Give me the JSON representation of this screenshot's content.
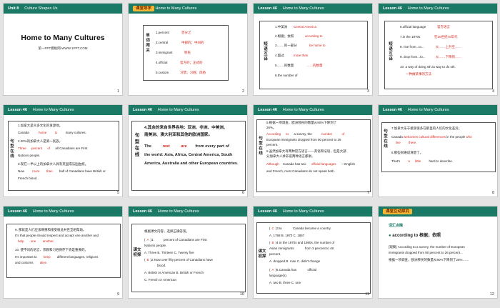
{
  "header": {
    "unit": "Unit 8",
    "unit_title": "Culture Shapes Us",
    "lesson": "Lesson 46",
    "lesson_title": "Home to Many Cultures",
    "tag": "课堂导学"
  },
  "slide1": {
    "title": "Home to Many Cultures",
    "subtitle": "第一PPT模板网-WWW.1PPT.COM",
    "num": "1"
  },
  "slide2": {
    "side": "单词闯关",
    "lines": [
      "1.percent",
      "2.central",
      "3.immigrant",
      "4.official",
      "5.custom"
    ],
    "answers": [
      "百分之",
      "中部的；中间的",
      "移民",
      "官方的；正式的",
      "习惯；习俗；风俗"
    ],
    "num": "2"
  },
  "slide3": {
    "side": "短语互译",
    "lines": [
      "1.中美洲",
      "2.根据；依照",
      "3.……的一部分",
      "4.超过",
      "5.……的数量",
      "6.the number of"
    ],
    "answers": [
      "Central America",
      "according to",
      "be home to",
      "more than",
      "……的数量"
    ],
    "num": "3"
  },
  "slide4": {
    "side": "短语互译",
    "lines": [
      "6.official language",
      "7.in the 1970s",
      "8. rise from...to...",
      "9. drop from...to...",
      "10. a way of doing sth./a way to do sth."
    ],
    "answers": [
      "官方语言",
      "在20世纪70年代",
      "从……上升至……",
      "从……下降到……",
      "一种做某事的方法"
    ],
    "num": "4"
  },
  "slide5": {
    "side": "句型在线",
    "lines": [
      "1.加拿大是众多文化的发源地。",
      "Canada",
      "home",
      "to",
      "many cultures.",
      "2.20%的加拿大人是第一民族。",
      "Three",
      "percent",
      "of",
      "all Canadians are First",
      "Nations people.",
      "3.现在一半以上的加拿大人具有英国或法国血统。",
      "Now",
      "more",
      "than",
      "half of Canadians have British or",
      "French blood."
    ],
    "num": "5"
  },
  "slide6": {
    "side": "句型在线",
    "lines": [
      "4.其余的来自世界各地：亚洲、非洲、中美洲、",
      "南美洲、澳大利亚和其他的欧洲国家。",
      "The",
      "rest",
      "are",
      "from every part of",
      "the world: Asia, Africa, Central America, South",
      "America, Australia and other European countries."
    ],
    "num": "6"
  },
  "slide7": {
    "side": "句型在线",
    "lines": [
      "5.根据一项调查，欧洲移民的数量从90%下降到了",
      "26%。",
      "According",
      "to",
      "a survey, the",
      "number",
      "of",
      "European immigrants dropped from 90 percent to 26",
      "percent.",
      "6.虽然加拿大有两种官方语言——英语和法语，但是大部",
      "分加拿大人并非说两种语言都讲。",
      "Although",
      "Canada has two",
      "official languages",
      "—English",
      "and French, most Canadians do not speak both."
    ],
    "num": "7"
  },
  "slide8": {
    "side": "句型在线",
    "lines": [
      "7.加拿大乐于接受很多在那里的人们的文化差异。",
      "Canada",
      "welcomes",
      "cultural",
      "differences",
      "in the people",
      "who",
      "live",
      "there.",
      "8.那些很难说清楚了。",
      "That's",
      "a",
      "little",
      "hard to describe."
    ],
    "num": "8"
  },
  "slide9": {
    "side": "",
    "lines": [
      "9. 那就是人们应该尊重和接受彼此并且互相帮助。",
      "It's that people should respect and accept one another and",
      "help",
      "one",
      "another.",
      "10. 使不同的语言、宗教和习俗保存下去是重要的。",
      "It's important to",
      "keep",
      "different languages, religions",
      "and customs",
      "alive."
    ],
    "num": "9"
  },
  "slide10": {
    "side": "课文初探",
    "lines": [
      "根据课文内容，选择正确答案。",
      "(",
      "A",
      ")1.",
      "percent of Canadians are First",
      "Nations people.",
      "A. Three      B. Thirteen      C. Twenty five",
      "(",
      "B",
      ")2.Now over fifty percent of Canadians have",
      "blood.",
      "A. British or American      B. British or French",
      "C. French or American"
    ],
    "num": "10"
  },
  "slide11": {
    "side": "课文初探",
    "lines": [
      "(",
      "C",
      ")3.In",
      "Canada became a country.",
      "A. 1768      B. 1970      C. 1867",
      "(",
      "B",
      ")4.In the 1970s and 1980s, the number of",
      "Asian immigrants",
      "from 3 percent to 48",
      "percent.",
      "A. dropped      B. rose      C. didn't change",
      "(",
      "A",
      ")5.Canada has",
      "official",
      "language(s).",
      "A. two      B. three      C. one"
    ],
    "num": "11"
  },
  "slide12": {
    "tag": "课堂互动探究",
    "lines": [
      "词汇点睛",
      "according to 根据；依照",
      "[观察] According to a survey, the number of European",
      "immigrants dropped from 90 percent to 26 percent...",
      "根据一项调查，欧洲移民的数量从90%下降到了26%……"
    ],
    "num": "12"
  }
}
